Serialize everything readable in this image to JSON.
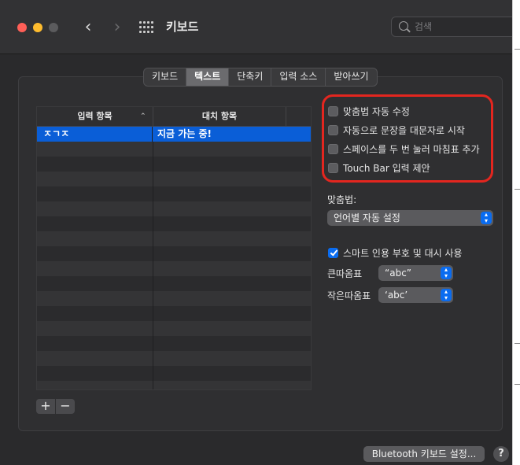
{
  "window": {
    "title": "키보드"
  },
  "search": {
    "placeholder": "검색"
  },
  "tabs": [
    {
      "label": "키보드",
      "active": false
    },
    {
      "label": "텍스트",
      "active": true
    },
    {
      "label": "단축키",
      "active": false
    },
    {
      "label": "입력 소스",
      "active": false
    },
    {
      "label": "받아쓰기",
      "active": false
    }
  ],
  "table": {
    "columns": [
      "입력 항목",
      "대치 항목"
    ],
    "rows": [
      {
        "input": "ㅈㄱㅈ",
        "replace": "지금 가는 중!",
        "selected": true
      }
    ]
  },
  "list_buttons": {
    "add": "+",
    "remove": "−"
  },
  "options": {
    "checkboxes": [
      {
        "label": "맞춤법 자동 수정",
        "checked": false
      },
      {
        "label": "자동으로 문장을 대문자로 시작",
        "checked": false
      },
      {
        "label": "스페이스를 두 번 눌러 마침표 추가",
        "checked": false
      },
      {
        "label": "Touch Bar 입력 제안",
        "checked": false
      }
    ],
    "spelling_label": "맞춤법:",
    "spelling_value": "언어별 자동 설정",
    "smart_quotes": {
      "label": "스마트 인용 부호 및 대시 사용",
      "checked": true
    },
    "double_quotes_label": "큰따옴표",
    "double_quotes_value": "“abc”",
    "single_quotes_label": "작은따옴표",
    "single_quotes_value": "‘abc’"
  },
  "footer": {
    "bluetooth_button": "Bluetooth 키보드 설정...",
    "help": "?"
  },
  "colors": {
    "accent": "#0a6cf0",
    "highlight": "#e3261f",
    "close": "#ff5f57",
    "minimize": "#febc2e"
  }
}
